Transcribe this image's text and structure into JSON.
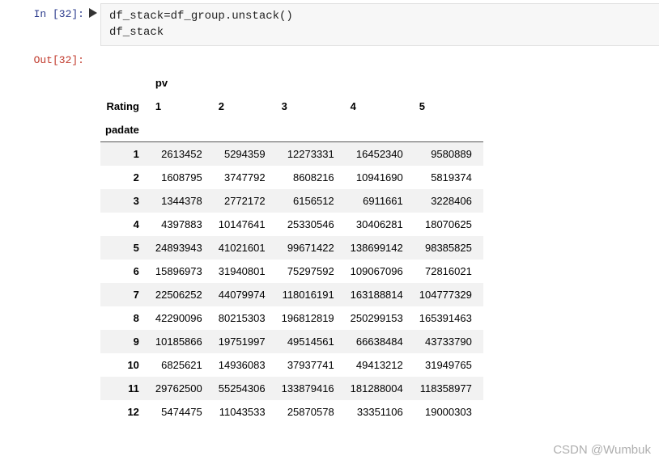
{
  "cell": {
    "in_prompt": "In [32]:",
    "out_prompt": "Out[32]:",
    "code_line1": "df_stack=df_group.unstack()",
    "code_line2": "df_stack"
  },
  "table": {
    "super_header": "pv",
    "col_index_name": "Rating",
    "row_index_name": "padate",
    "columns": [
      "1",
      "2",
      "3",
      "4",
      "5"
    ],
    "rows": [
      {
        "idx": "1",
        "vals": [
          "2613452",
          "5294359",
          "12273331",
          "16452340",
          "9580889"
        ]
      },
      {
        "idx": "2",
        "vals": [
          "1608795",
          "3747792",
          "8608216",
          "10941690",
          "5819374"
        ]
      },
      {
        "idx": "3",
        "vals": [
          "1344378",
          "2772172",
          "6156512",
          "6911661",
          "3228406"
        ]
      },
      {
        "idx": "4",
        "vals": [
          "4397883",
          "10147641",
          "25330546",
          "30406281",
          "18070625"
        ]
      },
      {
        "idx": "5",
        "vals": [
          "24893943",
          "41021601",
          "99671422",
          "138699142",
          "98385825"
        ]
      },
      {
        "idx": "6",
        "vals": [
          "15896973",
          "31940801",
          "75297592",
          "109067096",
          "72816021"
        ]
      },
      {
        "idx": "7",
        "vals": [
          "22506252",
          "44079974",
          "118016191",
          "163188814",
          "104777329"
        ]
      },
      {
        "idx": "8",
        "vals": [
          "42290096",
          "80215303",
          "196812819",
          "250299153",
          "165391463"
        ]
      },
      {
        "idx": "9",
        "vals": [
          "10185866",
          "19751997",
          "49514561",
          "66638484",
          "43733790"
        ]
      },
      {
        "idx": "10",
        "vals": [
          "6825621",
          "14936083",
          "37937741",
          "49413212",
          "31949765"
        ]
      },
      {
        "idx": "11",
        "vals": [
          "29762500",
          "55254306",
          "133879416",
          "181288004",
          "118358977"
        ]
      },
      {
        "idx": "12",
        "vals": [
          "5474475",
          "11043533",
          "25870578",
          "33351106",
          "19000303"
        ]
      }
    ]
  },
  "watermark": "CSDN @Wumbuk",
  "chart_data": {
    "type": "table",
    "title": "pv by Rating and padate",
    "row_index": "padate",
    "col_index": "Rating",
    "columns": [
      1,
      2,
      3,
      4,
      5
    ],
    "index": [
      1,
      2,
      3,
      4,
      5,
      6,
      7,
      8,
      9,
      10,
      11,
      12
    ],
    "values": [
      [
        2613452,
        5294359,
        12273331,
        16452340,
        9580889
      ],
      [
        1608795,
        3747792,
        8608216,
        10941690,
        5819374
      ],
      [
        1344378,
        2772172,
        6156512,
        6911661,
        3228406
      ],
      [
        4397883,
        10147641,
        25330546,
        30406281,
        18070625
      ],
      [
        24893943,
        41021601,
        99671422,
        138699142,
        98385825
      ],
      [
        15896973,
        31940801,
        75297592,
        109067096,
        72816021
      ],
      [
        22506252,
        44079974,
        118016191,
        163188814,
        104777329
      ],
      [
        42290096,
        80215303,
        196812819,
        250299153,
        165391463
      ],
      [
        10185866,
        19751997,
        49514561,
        66638484,
        43733790
      ],
      [
        6825621,
        14936083,
        37937741,
        49413212,
        31949765
      ],
      [
        29762500,
        55254306,
        133879416,
        181288004,
        118358977
      ],
      [
        5474475,
        11043533,
        25870578,
        33351106,
        19000303
      ]
    ]
  }
}
